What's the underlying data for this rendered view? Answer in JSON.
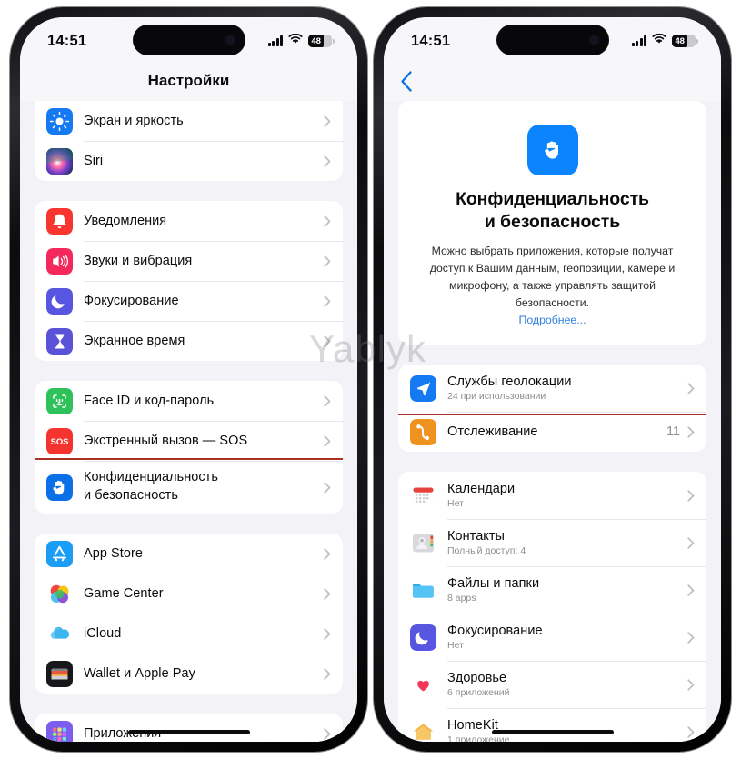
{
  "watermark": "Yablyk",
  "left_phone": {
    "status_bar": {
      "time": "14:51",
      "battery_percent": "48",
      "signal_icon": "cellular-bars-icon",
      "wifi_icon": "wifi-icon",
      "battery_icon": "battery-icon"
    },
    "nav": {
      "title": "Настройки"
    },
    "groups": [
      {
        "rows": [
          {
            "label": "Экран и яркость",
            "icon": "display-brightness-icon"
          },
          {
            "label": "Siri",
            "icon": "siri-icon"
          }
        ]
      },
      {
        "rows": [
          {
            "label": "Уведомления",
            "icon": "notifications-bell-icon"
          },
          {
            "label": "Звуки и вибрация",
            "icon": "sounds-haptics-icon"
          },
          {
            "label": "Фокусирование",
            "icon": "focus-moon-icon"
          },
          {
            "label": "Экранное время",
            "icon": "screen-time-hourglass-icon"
          }
        ]
      },
      {
        "rows": [
          {
            "label": "Face ID и код-пароль",
            "icon": "face-id-icon"
          },
          {
            "label": "Экстренный вызов — SOS",
            "icon": "sos-icon"
          },
          {
            "label": "Конфиденциальность и безопасность",
            "label_line1": "Конфиденциальность",
            "label_line2": "и безопасность",
            "icon": "privacy-hand-icon",
            "highlighted": true
          }
        ]
      },
      {
        "rows": [
          {
            "label": "App Store",
            "icon": "app-store-icon"
          },
          {
            "label": "Game Center",
            "icon": "game-center-icon"
          },
          {
            "label": "iCloud",
            "icon": "icloud-icon"
          },
          {
            "label": "Wallet и Apple Pay",
            "icon": "wallet-apple-pay-icon"
          }
        ]
      },
      {
        "rows": [
          {
            "label": "Приложения",
            "icon": "apps-grid-icon"
          }
        ]
      }
    ]
  },
  "right_phone": {
    "status_bar": {
      "time": "14:51",
      "battery_percent": "48",
      "signal_icon": "cellular-bars-icon",
      "wifi_icon": "wifi-icon",
      "battery_icon": "battery-icon"
    },
    "nav": {
      "back_icon": "chevron-left-icon"
    },
    "hero": {
      "icon": "privacy-hand-icon",
      "title_line1": "Конфиденциальность",
      "title_line2": "и безопасность",
      "description": "Можно выбрать приложения, которые получат доступ к Вашим данным, геопозиции, камере и микрофону, а также управлять защитой безопасности.",
      "link": "Подробнее..."
    },
    "groups": [
      {
        "rows": [
          {
            "label": "Службы геолокации",
            "sub": "24 при использовании",
            "icon": "location-services-icon",
            "highlighted": true
          },
          {
            "label": "Отслеживание",
            "trail": "11",
            "icon": "tracking-icon"
          }
        ]
      },
      {
        "rows": [
          {
            "label": "Календари",
            "sub": "Нет",
            "icon": "calendar-icon"
          },
          {
            "label": "Контакты",
            "sub": "Полный доступ: 4",
            "icon": "contacts-icon"
          },
          {
            "label": "Файлы и папки",
            "sub": "8 apps",
            "icon": "files-folders-icon"
          },
          {
            "label": "Фокусирование",
            "sub": "Нет",
            "icon": "focus-moon-icon"
          },
          {
            "label": "Здоровье",
            "sub": "6 приложений",
            "icon": "health-heart-icon"
          },
          {
            "label": "HomeKit",
            "sub": "1 приложение",
            "icon": "homekit-icon"
          }
        ]
      }
    ]
  },
  "colors": {
    "highlight_border": "#a93226",
    "accent_blue": "#0b84fe",
    "link_blue": "#2f7fe0",
    "page_bg": "#f2f2f7",
    "card_bg": "#ffffff",
    "secondary_text": "#8d8d93"
  }
}
